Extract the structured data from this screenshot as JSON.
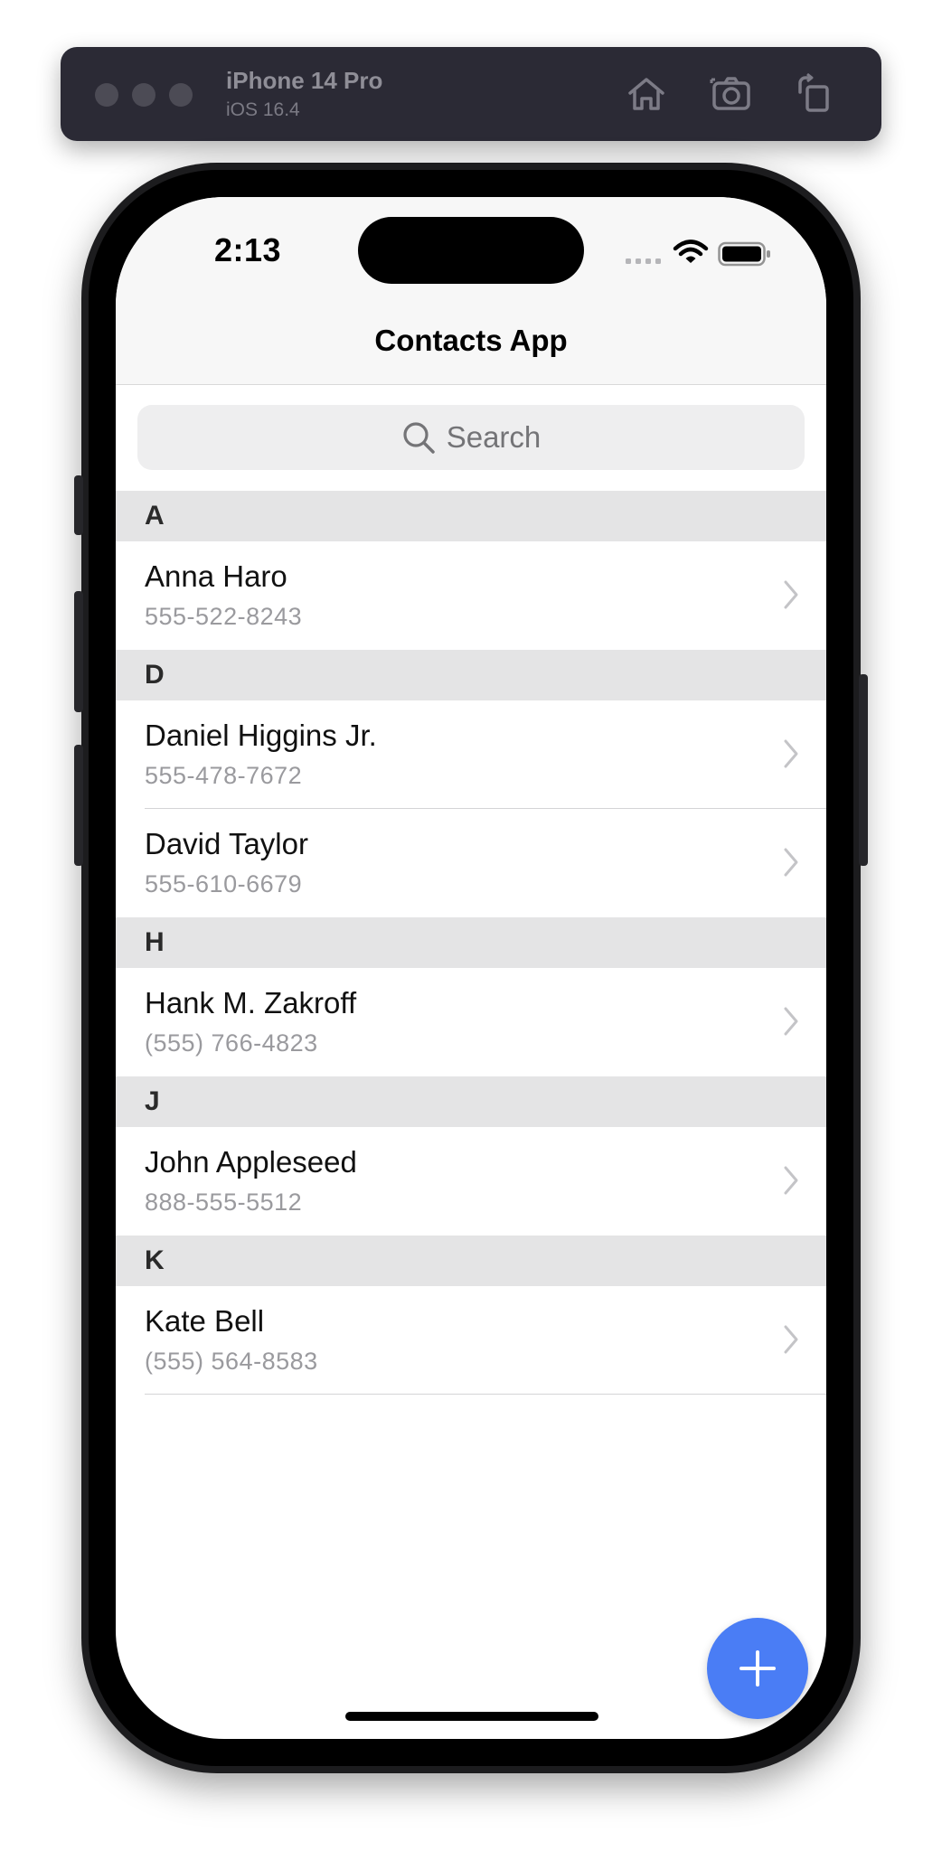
{
  "simulator": {
    "device_name": "iPhone 14 Pro",
    "os_version": "iOS 16.4",
    "icons": [
      "home-icon",
      "screenshot-icon",
      "rotate-icon"
    ]
  },
  "status_bar": {
    "time": "2:13",
    "icons": [
      "cellular-icon",
      "wifi-icon",
      "battery-icon"
    ]
  },
  "nav": {
    "title": "Contacts App"
  },
  "search": {
    "placeholder": "Search",
    "value": ""
  },
  "sections": [
    {
      "letter": "A",
      "contacts": [
        {
          "name": "Anna Haro",
          "phone": "555-522-8243"
        }
      ]
    },
    {
      "letter": "D",
      "contacts": [
        {
          "name": "Daniel Higgins Jr.",
          "phone": "555-478-7672"
        },
        {
          "name": "David Taylor",
          "phone": "555-610-6679"
        }
      ]
    },
    {
      "letter": "H",
      "contacts": [
        {
          "name": "Hank M. Zakroff",
          "phone": "(555) 766-4823"
        }
      ]
    },
    {
      "letter": "J",
      "contacts": [
        {
          "name": "John Appleseed",
          "phone": "888-555-5512"
        }
      ]
    },
    {
      "letter": "K",
      "contacts": [
        {
          "name": "Kate Bell",
          "phone": "(555) 564-8583"
        }
      ]
    }
  ],
  "fab": {
    "icon": "plus-icon"
  },
  "colors": {
    "accent": "#4a7df5",
    "section_bg": "#e4e4e5",
    "secondary_text": "#9a9a9e"
  }
}
